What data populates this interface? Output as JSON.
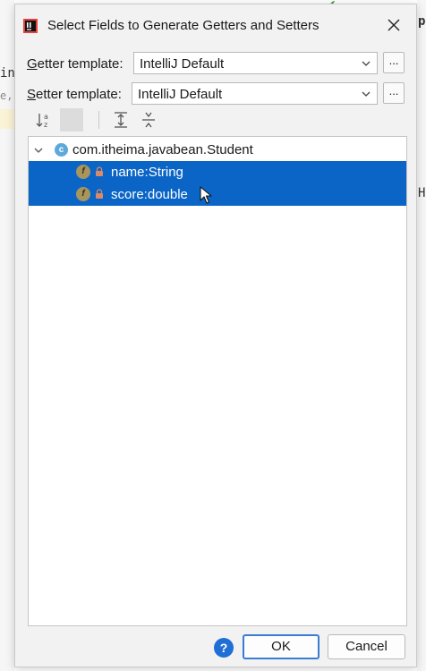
{
  "dialog": {
    "title": "Select Fields to Generate Getters and Setters",
    "app_icon": "intellij-icon",
    "close_icon": "close-icon"
  },
  "getter": {
    "label_accel": "G",
    "label_rest": "etter template:",
    "value": "IntelliJ Default",
    "more": "..."
  },
  "setter": {
    "label_accel": "S",
    "label_rest": "etter template:",
    "value": "IntelliJ Default",
    "more": "..."
  },
  "toolbar": {
    "icons": [
      "sort-alpha-icon",
      "toggle-icon",
      "expand-all-icon",
      "collapse-all-icon"
    ]
  },
  "tree": {
    "root": {
      "label": "com.itheima.javabean.Student",
      "badge": "c"
    },
    "fields": [
      {
        "label": "name:String",
        "badge": "f",
        "selected": true
      },
      {
        "label": "score:double",
        "badge": "f",
        "selected": true
      }
    ]
  },
  "footer": {
    "help": "?",
    "ok": "OK",
    "cancel": "Cancel"
  },
  "background": {
    "left_fragments": [
      "in",
      "e,"
    ],
    "right_fragments": [
      "p",
      "H"
    ]
  },
  "colors": {
    "selection": "#0a65c6",
    "field_badge": "#a7955e",
    "class_badge": "#5da9dc",
    "help": "#1f6fd6",
    "default_border": "#3a7cd3"
  }
}
